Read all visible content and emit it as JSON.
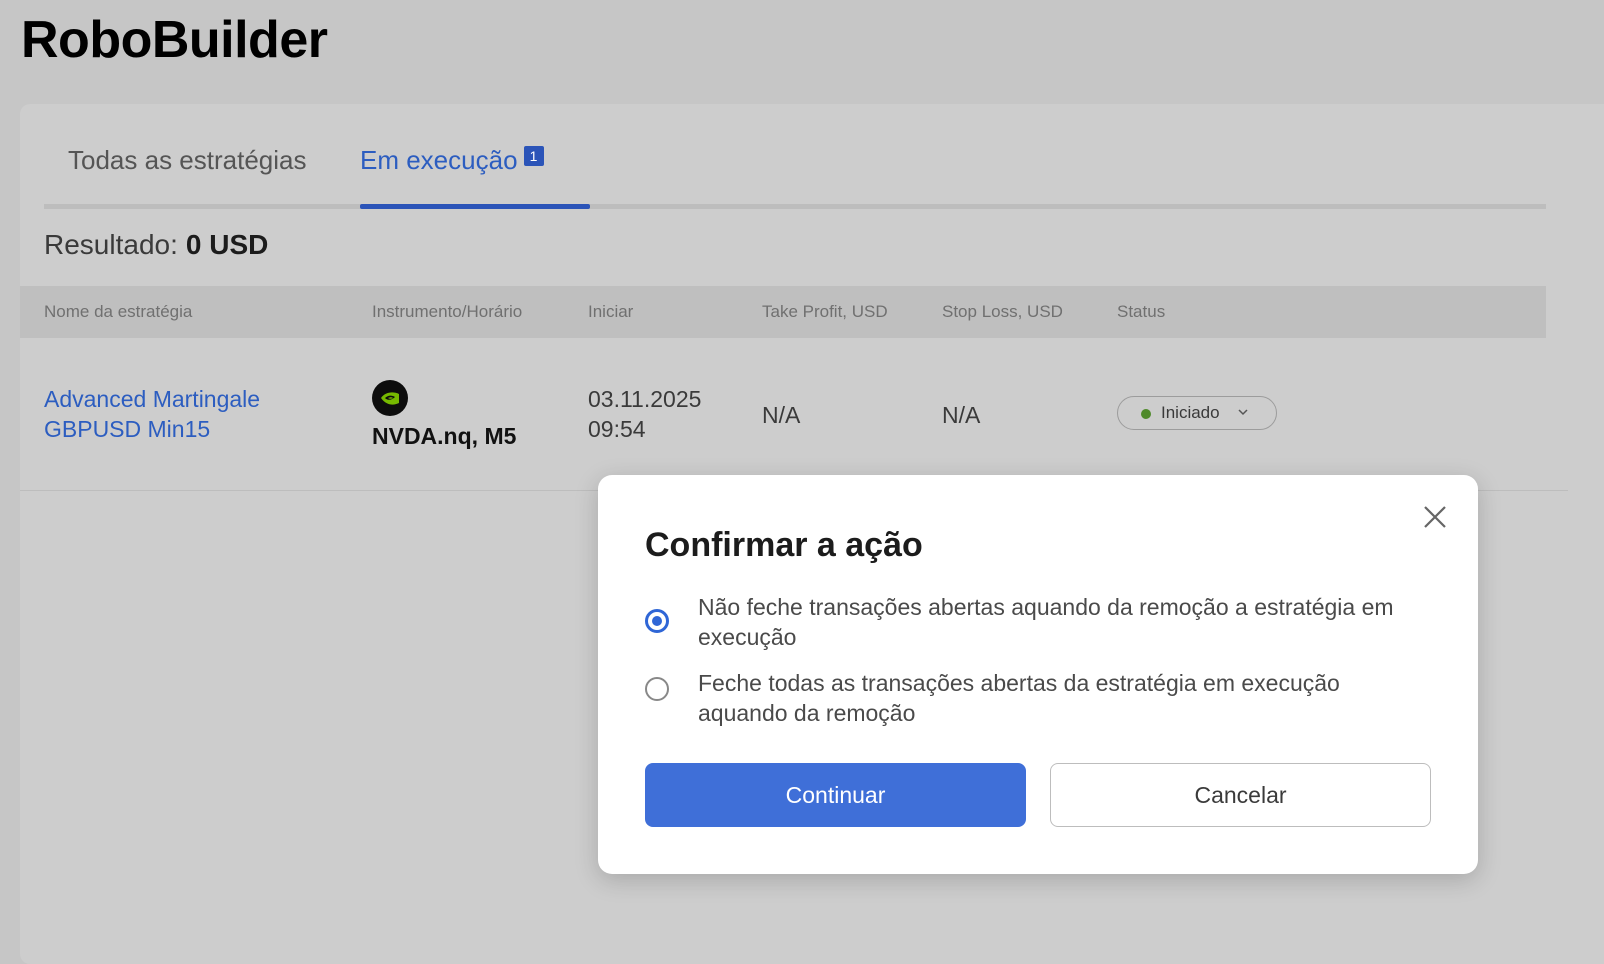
{
  "app": {
    "title": "RoboBuilder"
  },
  "tabs": {
    "all_label": "Todas as estratégias",
    "running_label": "Em execução",
    "running_count": "1"
  },
  "result": {
    "label": "Resultado:",
    "value": "0 USD"
  },
  "table": {
    "headers": {
      "name": "Nome da estratégia",
      "instrument": "Instrumento/Horário",
      "start": "Iniciar",
      "take_profit": "Take Profit, USD",
      "stop_loss": "Stop Loss, USD",
      "status": "Status"
    },
    "rows": [
      {
        "name_line1": "Advanced Martingale",
        "name_line2": "GBPUSD Min15",
        "instrument_icon": "nvidia-logo-icon",
        "instrument": "NVDA.nq, M5",
        "start_date": "03.11.2025",
        "start_time": "09:54",
        "take_profit": "N/A",
        "stop_loss": "N/A",
        "status": "Iniciado",
        "status_color": "#4f8a2a"
      }
    ]
  },
  "modal": {
    "title": "Confirmar a ação",
    "options": [
      {
        "label": "Não feche transações abertas aquando da remoção a estratégia em execução",
        "selected": true
      },
      {
        "label": "Feche todas as transações abertas da estratégia em execução aquando da remoção",
        "selected": false
      }
    ],
    "continue_label": "Continuar",
    "cancel_label": "Cancelar"
  },
  "colors": {
    "accent": "#2b54b8",
    "primary_button": "#3f6fd8",
    "link": "#2c5dc0"
  }
}
